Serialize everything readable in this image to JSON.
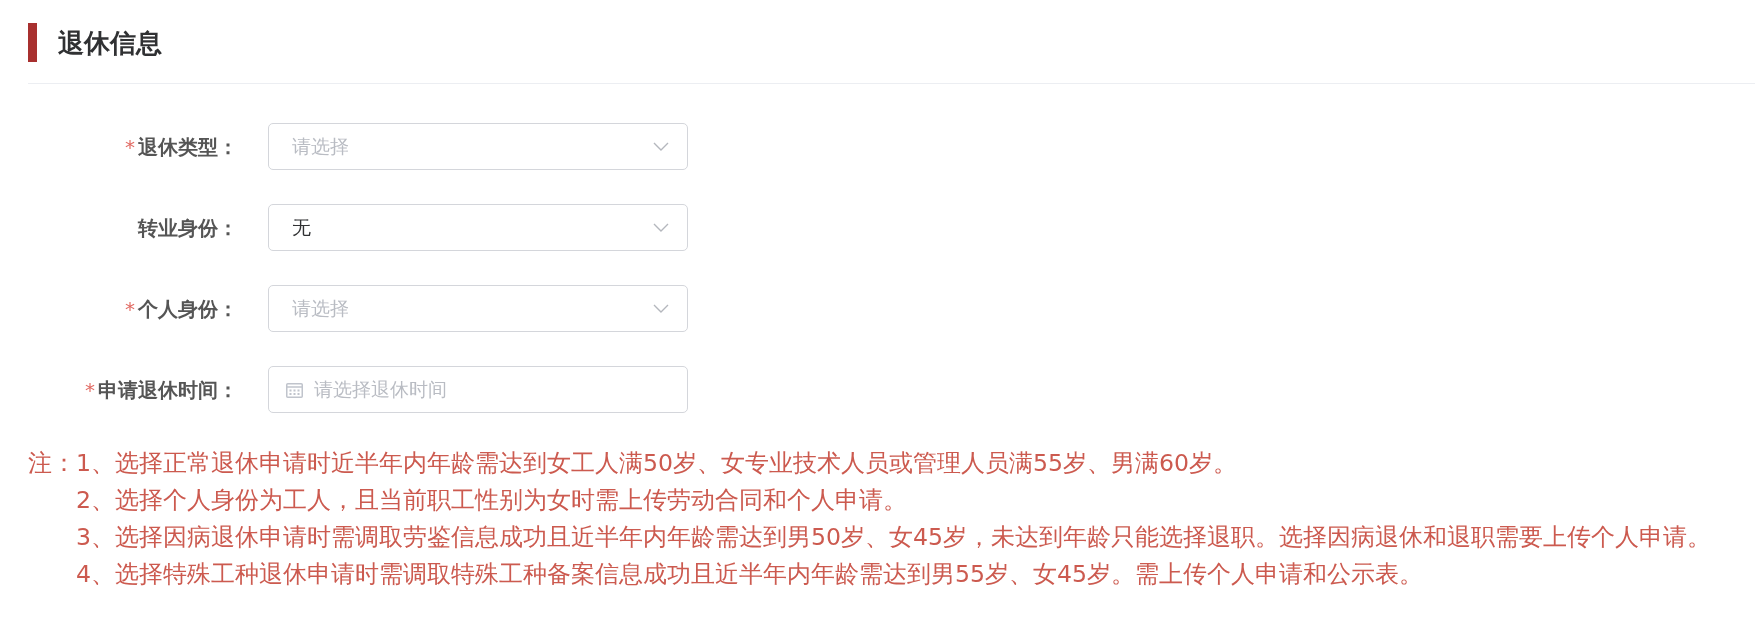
{
  "section": {
    "title": "退休信息"
  },
  "form": {
    "fields": [
      {
        "kind": "select",
        "required_mark": "*",
        "label": "退休类型：",
        "placeholder": "请选择"
      },
      {
        "kind": "select",
        "label": "转业身份：",
        "value": "无"
      },
      {
        "kind": "select",
        "required_mark": "*",
        "label": "个人身份：",
        "placeholder": "请选择"
      },
      {
        "kind": "date",
        "required_mark": "*",
        "label": "申请退休时间：",
        "placeholder": "请选择退休时间"
      }
    ]
  },
  "notes": {
    "prefix": "注：",
    "items": [
      "1、选择正常退休申请时近半年内年龄需达到女工人满50岁、女专业技术人员或管理人员满55岁、男满60岁。",
      "2、选择个人身份为工人，且当前职工性别为女时需上传劳动合同和个人申请。",
      "3、选择因病退休申请时需调取劳鉴信息成功且近半年内年龄需达到男50岁、女45岁，未达到年龄只能选择退职。选择因病退休和退职需要上传个人申请。",
      "4、选择特殊工种退休申请时需调取特殊工种备案信息成功且近半年内年龄需达到男55岁、女45岁。需上传个人申请和公示表。"
    ]
  }
}
